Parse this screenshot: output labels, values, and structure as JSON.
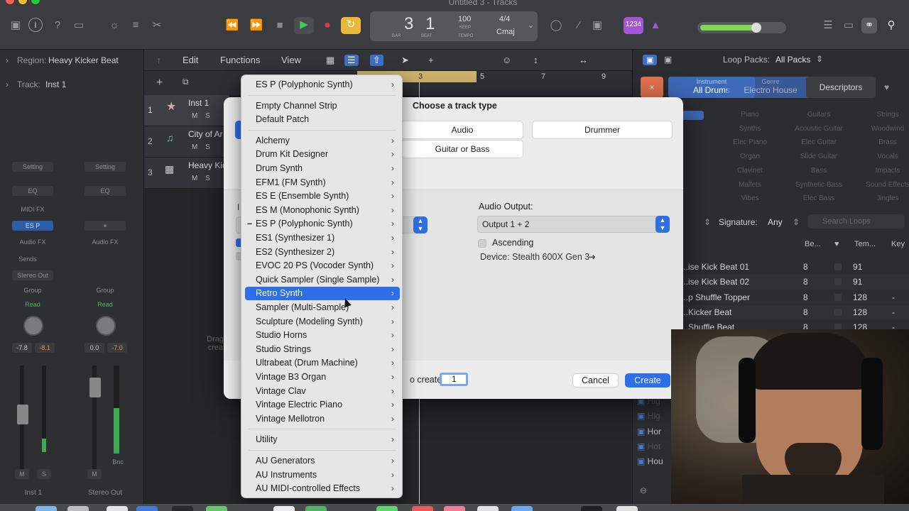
{
  "window": {
    "title": "Untitled 3 - Tracks"
  },
  "lcd": {
    "bar": "3",
    "beat": "1",
    "bar_label": "BAR",
    "beat_label": "BEAT",
    "tempo": "100",
    "tempo_mode": "KEEP",
    "tempo_label": "TEMPO",
    "signature": "4/4",
    "key": "Cmaj",
    "count_in": "1234"
  },
  "controlbar": {
    "edit": "Edit",
    "functions": "Functions",
    "view": "View",
    "ruler": [
      "3",
      "5",
      "7",
      "9"
    ]
  },
  "inspector": {
    "region_label": "Region:",
    "region_name": "Heavy Kicker Beat",
    "track_label": "Track:",
    "track_name": "Inst 1",
    "strip1": {
      "setting": "Setting",
      "eq": "EQ",
      "midi_fx": "MIDI FX",
      "instrument": "ES P",
      "audio_fx": "Audio FX",
      "sends": "Sends",
      "output": "Stereo Out",
      "group": "Group",
      "automation": "Read",
      "pan_left": "-7.8",
      "pan_right": "-8.1",
      "m": "M",
      "s": "S",
      "name": "Inst 1"
    },
    "strip2": {
      "setting": "Setting",
      "eq": "EQ",
      "audio_fx": "Audio FX",
      "group": "Group",
      "automation": "Read",
      "pan_left": "0.0",
      "pan_right": "-7.0",
      "m": "M",
      "bnc": "Bnc",
      "name": "Stereo Out"
    }
  },
  "tracks": [
    {
      "num": "1",
      "name": "Inst 1",
      "m": "M",
      "s": "S"
    },
    {
      "num": "2",
      "name": "City of Ar",
      "m": "M",
      "s": "S"
    },
    {
      "num": "3",
      "name": "Heavy Kic",
      "m": "M",
      "s": "S"
    }
  ],
  "tracks_hint": "Drag A\ncreate",
  "browser": {
    "loop_packs_label": "Loop Packs:",
    "loop_packs_value": "All Packs",
    "tab_instrument_top": "Instrument",
    "tab_instrument_value": "All Drums",
    "tab_genre_top": "Genre",
    "tab_genre_value": "Electro House",
    "tab_descriptors": "Descriptors",
    "tag_grid": [
      "Piano",
      "Guitars",
      "Strings",
      "Synths",
      "Acoustic Guitar",
      "Woodwind",
      "Elec Piano",
      "Elec Guitar",
      "Brass",
      "Organ",
      "Slide Guitar",
      "Vocals",
      "Clavinet",
      "Bass",
      "Impacts",
      "Mallets",
      "Synthetic Bass",
      "Sound Effects",
      "Vibes",
      "Elec Bass",
      "Jingles"
    ],
    "signature_label": "Signature:",
    "signature_value": "Any",
    "search_placeholder": "Search Loops",
    "col_beats": "Be...",
    "col_tempo": "Tem...",
    "col_key": "Key",
    "loops": [
      {
        "name": "...ise Kick Beat 01",
        "beats": "8",
        "tempo": "91",
        "key": ""
      },
      {
        "name": "...ise Kick Beat 02",
        "beats": "8",
        "tempo": "91",
        "key": ""
      },
      {
        "name": "...p Shuffle Topper",
        "beats": "8",
        "tempo": "128",
        "key": "-"
      },
      {
        "name": "...Kicker Beat",
        "beats": "8",
        "tempo": "128",
        "key": "-"
      },
      {
        "name": "...Shuffle Beat",
        "beats": "8",
        "tempo": "128",
        "key": "-"
      }
    ],
    "lower_list": [
      "Hig",
      "Hig",
      "Hor",
      "Hot",
      "Hou"
    ]
  },
  "dialog": {
    "title": "Choose a track type",
    "types": {
      "audio": "Audio",
      "drummer": "Drummer",
      "guitar_bass": "Guitar or Bass"
    },
    "audio_output_label": "Audio Output:",
    "audio_output_value": "Output 1 + 2",
    "ascending_label": "Ascending",
    "device_label": "Device: Stealth 600X Gen 3",
    "create_count_label": "o create:",
    "create_count_value": "1",
    "cancel": "Cancel",
    "create": "Create"
  },
  "menu": {
    "items": [
      {
        "label": "ES P  (Polyphonic Synth)",
        "submenu": true
      },
      {
        "sep": true
      },
      {
        "label": "Empty Channel Strip",
        "submenu": false
      },
      {
        "label": "Default Patch",
        "submenu": false
      },
      {
        "sep": true
      },
      {
        "label": "Alchemy",
        "submenu": true
      },
      {
        "label": "Drum Kit Designer",
        "submenu": true
      },
      {
        "label": "Drum Synth",
        "submenu": true
      },
      {
        "label": "EFM1  (FM Synth)",
        "submenu": true
      },
      {
        "label": "ES E  (Ensemble Synth)",
        "submenu": true
      },
      {
        "label": "ES M  (Monophonic Synth)",
        "submenu": true
      },
      {
        "label": "ES P  (Polyphonic Synth)",
        "submenu": true,
        "checked": true
      },
      {
        "label": "ES1  (Synthesizer 1)",
        "submenu": true
      },
      {
        "label": "ES2  (Synthesizer 2)",
        "submenu": true
      },
      {
        "label": "EVOC 20 PS  (Vocoder Synth)",
        "submenu": true
      },
      {
        "label": "Quick Sampler (Single Sample)",
        "submenu": true
      },
      {
        "label": "Retro Synth",
        "submenu": true,
        "selected": true
      },
      {
        "label": "Sampler (Multi-Sample)",
        "submenu": true
      },
      {
        "label": "Sculpture  (Modeling Synth)",
        "submenu": true
      },
      {
        "label": "Studio Horns",
        "submenu": true
      },
      {
        "label": "Studio Strings",
        "submenu": true
      },
      {
        "label": "Ultrabeat (Drum Machine)",
        "submenu": true
      },
      {
        "label": "Vintage B3 Organ",
        "submenu": true
      },
      {
        "label": "Vintage Clav",
        "submenu": true
      },
      {
        "label": "Vintage Electric Piano",
        "submenu": true
      },
      {
        "label": "Vintage Mellotron",
        "submenu": true
      },
      {
        "sep": true
      },
      {
        "label": "Utility",
        "submenu": true
      },
      {
        "sep": true
      },
      {
        "label": "AU Generators",
        "submenu": true
      },
      {
        "label": "AU Instruments",
        "submenu": true
      },
      {
        "label": "AU MIDI-controlled Effects",
        "submenu": true
      }
    ]
  }
}
